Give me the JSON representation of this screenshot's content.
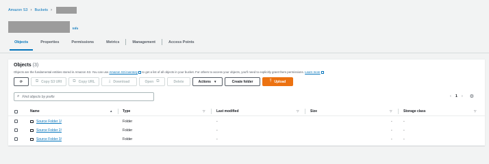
{
  "breadcrumb": {
    "root": "Amazon S3",
    "buckets": "Buckets"
  },
  "title": {
    "info": "Info"
  },
  "tabs": [
    "Objects",
    "Properties",
    "Permissions",
    "Metrics",
    "Management",
    "Access Points"
  ],
  "objects": {
    "heading": "Objects",
    "count": "(3)",
    "desc_before": "Objects are the fundamental entities stored in Amazon S3. You can use ",
    "desc_link1": "Amazon S3 inventory",
    "desc_middle": " to get a list of all objects in your bucket. For others to access your objects, you'll need to explicitly grant them permissions.",
    "desc_link2": "Learn more"
  },
  "toolbar": {
    "refresh_icon": "refresh-icon",
    "copy_uri": "Copy S3 URI",
    "copy_url": "Copy URL",
    "download": "Download",
    "open": "Open",
    "delete": "Delete",
    "actions": "Actions",
    "create_folder": "Create folder",
    "upload": "Upload"
  },
  "search": {
    "placeholder": "Find objects by prefix"
  },
  "pager": {
    "page": "1"
  },
  "table": {
    "headers": {
      "name": "Name",
      "type": "Type",
      "last_modified": "Last modified",
      "size": "Size",
      "storage_class": "Storage class"
    },
    "rows": [
      {
        "name": "Source Folder 1/",
        "type": "Folder",
        "last_modified": "-",
        "size": "-",
        "storage_class": "-"
      },
      {
        "name": "Source Folder 2/",
        "type": "Folder",
        "last_modified": "-",
        "size": "-",
        "storage_class": "-"
      },
      {
        "name": "Source Folder 3/",
        "type": "Folder",
        "last_modified": "-",
        "size": "-",
        "storage_class": "-"
      }
    ]
  },
  "colors": {
    "link": "#0073bb",
    "primary": "#ec7211",
    "background": "#f2f3f3"
  }
}
